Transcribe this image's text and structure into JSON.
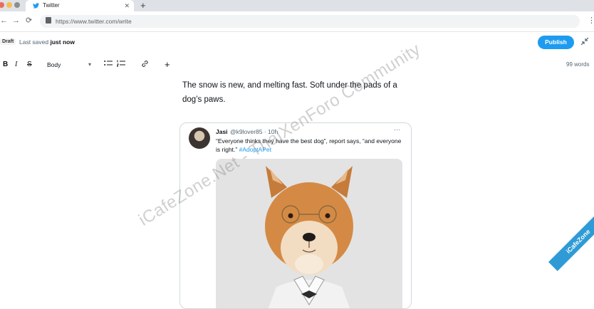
{
  "browser": {
    "tab_title": "Twitter",
    "tab_close": "✕",
    "new_tab": "+",
    "url": "https://www.twitter.com/write"
  },
  "editor": {
    "status_badge": "Draft",
    "saved_prefix": "Last saved",
    "saved_time": "just now",
    "publish_label": "Publish",
    "format": {
      "bold": "B",
      "italic": "I",
      "strike": "S",
      "style_value": "Body"
    },
    "word_count": "99 words",
    "paragraph": "The snow is new, and melting fast. Soft under the pads of a dog’s paws."
  },
  "tweet": {
    "name": "Jasi",
    "handle_time": "@k9lover85 · 10h",
    "more": "···",
    "text": "“Everyone thinks they have the best dog”, report says, “and everyone is right.”",
    "hashtag": "#AdoptAPet"
  },
  "watermarks": {
    "diagonal": "iCafeZone.Net - ThaiXenForo Community",
    "ribbon": "iCafeZone"
  },
  "colors": {
    "accent": "#1d9bf0",
    "text": "#0f1419",
    "muted": "#536471"
  },
  "icons": [
    "twitter-bird-icon",
    "back-icon",
    "forward-icon",
    "reload-icon",
    "lock-icon",
    "menu-kebab-icon",
    "collapse-icon",
    "bullet-list-icon",
    "numbered-list-icon",
    "link-icon",
    "plus-icon",
    "chevron-down-icon"
  ]
}
